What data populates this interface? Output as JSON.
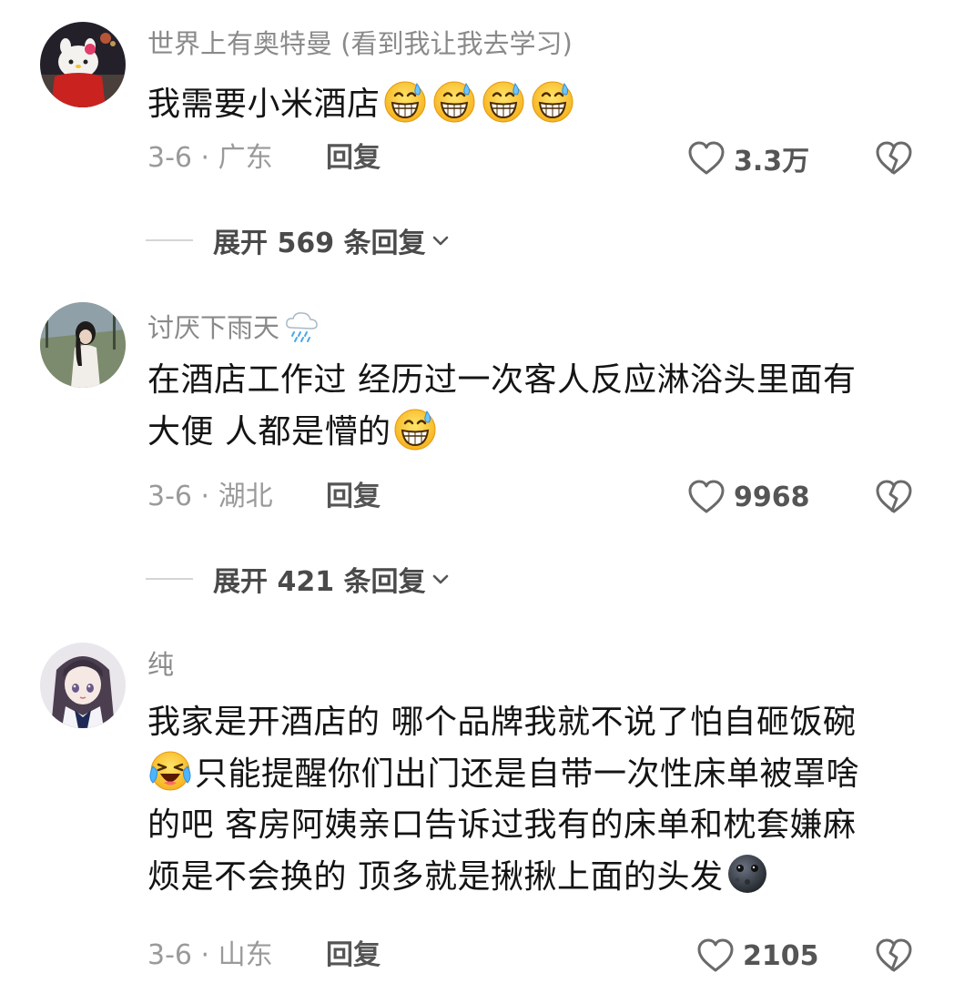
{
  "comments": [
    {
      "username": "世界上有奥特曼 (看到我让我去学习)",
      "text": "我需要小米酒店",
      "date": "3-6 · 广东",
      "reply_label": "回复",
      "likes": "3.3万",
      "expand_label": "展开 569 条回复",
      "emoji_count": 4,
      "emoji": "sweat-grin-emoji"
    },
    {
      "username": "讨厌下雨天",
      "username_emoji": "rain-cloud-emoji",
      "text_line1": "在酒店工作过 经历过一次客人反应淋浴头里面有",
      "text_line2": "大便 人都是懵的",
      "date": "3-6 · 湖北",
      "reply_label": "回复",
      "likes": "9968",
      "expand_label": "展开 421 条回复",
      "emoji": "sweat-grin-emoji"
    },
    {
      "username": "纯",
      "text_line1": "我家是开酒店的 哪个品牌我就不说了怕自砸饭碗",
      "text_line2": "只能提醒你们出门还是自带一次性床单被罩啥",
      "text_line3": "的吧 客房阿姨亲口告诉过我有的床单和枕套嫌麻",
      "text_line4": "烦是不会换的 顶多就是揪揪上面的头发",
      "date": "3-6 · 山东",
      "reply_label": "回复",
      "likes": "2105",
      "emoji_line2_start": "crying-laughing-emoji",
      "emoji_line4_end": "new-moon-face-emoji"
    }
  ],
  "colors": {
    "username": "#8a8a8a",
    "text": "#141414",
    "meta": "#9a9a9a",
    "action": "#555555"
  }
}
